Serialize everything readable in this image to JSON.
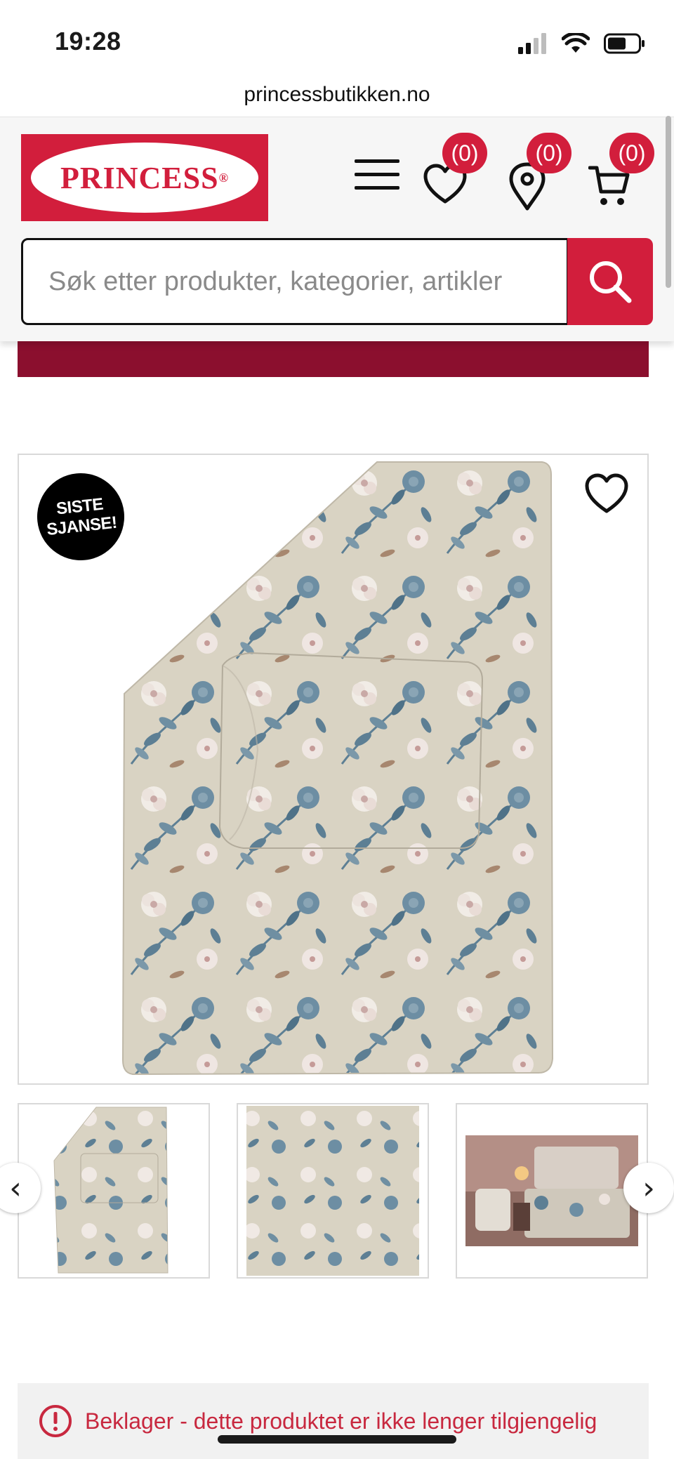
{
  "status_bar": {
    "time": "19:28",
    "icons": [
      "cellular-signal-icon",
      "wifi-icon",
      "battery-icon"
    ]
  },
  "browser": {
    "url": "princessbutikken.no"
  },
  "header": {
    "logo_text": "PRINCESS",
    "logo_mark": "®",
    "menu_icon": "hamburger-menu-icon",
    "wishlist_count": "(0)",
    "stores_count": "(0)",
    "cart_count": "(0)",
    "search_placeholder": "Søk etter produkter, kategorier, artikler",
    "search_value": ""
  },
  "product": {
    "badge_line1": "SISTE",
    "badge_line2": "SJANSE!",
    "thumbnails": [
      "thumbnail-duvet-set",
      "thumbnail-fabric-closeup",
      "thumbnail-bedroom-scene"
    ]
  },
  "notice": {
    "text": "Beklager - dette produktet er ikke lenger tilgjengelig"
  },
  "colors": {
    "brand_red": "#d21e3c",
    "banner_burgundy": "#8b0f2e",
    "fabric_base": "#d8d2c2",
    "leaf_blue": "#5d7f94"
  }
}
